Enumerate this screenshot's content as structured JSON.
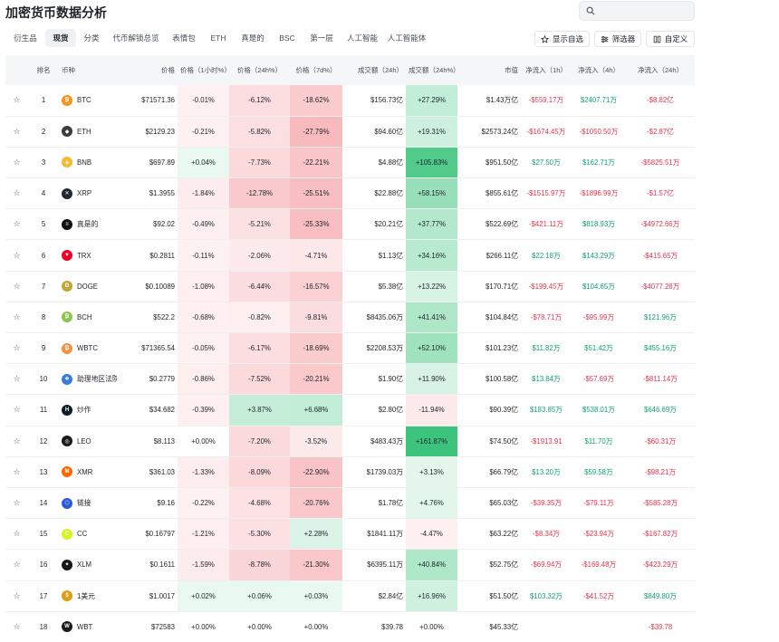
{
  "title": "加密货币数据分析",
  "search": {
    "placeholder": ""
  },
  "tabs": [
    {
      "label": "衍生品",
      "active": false,
      "w": 44
    },
    {
      "label": "现货",
      "active": true,
      "w": 34
    },
    {
      "label": "分类",
      "active": false,
      "w": 34
    },
    {
      "label": "代币解锁总览",
      "active": false,
      "w": 64
    },
    {
      "label": "表情包",
      "active": false,
      "w": 42
    },
    {
      "label": "ETH",
      "active": false,
      "w": 34
    },
    {
      "label": "真是的",
      "active": false,
      "w": 42
    },
    {
      "label": "BSC",
      "active": false,
      "w": 34
    },
    {
      "label": "第一层",
      "active": false,
      "w": 42
    },
    {
      "label": "人工智能",
      "active": false,
      "w": 48
    },
    {
      "label": "人工智能体",
      "active": false,
      "w": 50
    }
  ],
  "actions": {
    "watchlist": "显示自选",
    "filter": "筛选器",
    "custom": "自定义"
  },
  "colors": {
    "neg": "#e8344e",
    "pos": "#0ea46c"
  },
  "columns": [
    "",
    "排名",
    "币种",
    "价格",
    "价格（1小时%）",
    "价格（24h%）",
    "价格（7d%）",
    "成交额（24h）",
    "成交额（24h%）",
    "市值",
    "净流入（1h）",
    "净流入（4h）",
    "净流入（24h）"
  ],
  "rows": [
    {
      "rank": "1",
      "sym": "BTC",
      "icon": "₿",
      "ic": "#f7931a",
      "price": "$71571.36",
      "h1": "-0.01%",
      "h24": "-6.12%",
      "d7": "-18.62%",
      "vol": "$156.73亿",
      "volp": "+27.29%",
      "mcap": "$1.43万亿",
      "in1": "-$559.17万",
      "in4": "$2407.71万",
      "in24": "-$8.82亿"
    },
    {
      "rank": "2",
      "sym": "ETH",
      "icon": "◆",
      "ic": "#3c3c3d",
      "price": "$2129.23",
      "h1": "-0.21%",
      "h24": "-5.82%",
      "d7": "-27.79%",
      "vol": "$94.60亿",
      "volp": "+19.31%",
      "mcap": "$2573.24亿",
      "in1": "-$1674.45万",
      "in4": "-$1050.50万",
      "in24": "-$2.87亿"
    },
    {
      "rank": "3",
      "sym": "BNB",
      "icon": "◈",
      "ic": "#f3ba2f",
      "price": "$697.89",
      "h1": "+0.04%",
      "h24": "-7.73%",
      "d7": "-22.21%",
      "vol": "$4.88亿",
      "volp": "+105.83%",
      "mcap": "$951.50亿",
      "in1": "$27.50万",
      "in4": "$162.71万",
      "in24": "-$5825.51万"
    },
    {
      "rank": "4",
      "sym": "XRP",
      "icon": "✕",
      "ic": "#23292f",
      "price": "$1.3955",
      "h1": "-1.84%",
      "h24": "-12.78%",
      "d7": "-25.51%",
      "vol": "$22.88亿",
      "volp": "+58.15%",
      "mcap": "$855.61亿",
      "in1": "-$1515.97万",
      "in4": "-$1896.99万",
      "in24": "-$1.57亿"
    },
    {
      "rank": "5",
      "sym": "真是的",
      "icon": "≡",
      "ic": "#111111",
      "price": "$92.02",
      "h1": "-0.49%",
      "h24": "-5.21%",
      "d7": "-25.33%",
      "vol": "$20.21亿",
      "volp": "+37.77%",
      "mcap": "$522.69亿",
      "in1": "-$421.11万",
      "in4": "$818.93万",
      "in24": "-$4972.66万"
    },
    {
      "rank": "6",
      "sym": "TRX",
      "icon": "▼",
      "ic": "#ef0027",
      "price": "$0.2811",
      "h1": "-0.11%",
      "h24": "-2.06%",
      "d7": "-4.71%",
      "vol": "$1.13亿",
      "volp": "+34.16%",
      "mcap": "$266.11亿",
      "in1": "$22.18万",
      "in4": "$143.29万",
      "in24": "-$415.65万"
    },
    {
      "rank": "7",
      "sym": "DOGE",
      "icon": "Ð",
      "ic": "#c2a633",
      "price": "$0.10089",
      "h1": "-1.08%",
      "h24": "-6.44%",
      "d7": "-16.57%",
      "vol": "$5.38亿",
      "volp": "+13.22%",
      "mcap": "$170.71亿",
      "in1": "-$199.45万",
      "in4": "$104.65万",
      "in24": "-$4077.28万"
    },
    {
      "rank": "8",
      "sym": "BCH",
      "icon": "₿",
      "ic": "#8dc351",
      "price": "$522.2",
      "h1": "-0.68%",
      "h24": "-0.82%",
      "d7": "-9.81%",
      "vol": "$8435.06万",
      "volp": "+41.41%",
      "mcap": "$104.84亿",
      "in1": "-$78.71万",
      "in4": "-$95.99万",
      "in24": "$121.96万"
    },
    {
      "rank": "9",
      "sym": "WBTC",
      "icon": "₿",
      "ic": "#f09242",
      "price": "$71365.54",
      "h1": "-0.05%",
      "h24": "-6.17%",
      "d7": "-18.69%",
      "vol": "$2208.53万",
      "volp": "+52.10%",
      "mcap": "$101.23亿",
      "in1": "$11.82万",
      "in4": "$51.42万",
      "in24": "$455.16万"
    },
    {
      "rank": "10",
      "sym": "助理地区法院",
      "icon": "❖",
      "ic": "#3b7bd8",
      "price": "$0.2779",
      "h1": "-0.86%",
      "h24": "-7.52%",
      "d7": "-20.21%",
      "vol": "$1.90亿",
      "volp": "+11.90%",
      "mcap": "$100.58亿",
      "in1": "$13.84万",
      "in4": "-$57.69万",
      "in24": "-$811.14万"
    },
    {
      "rank": "11",
      "sym": "炒作",
      "icon": "H",
      "ic": "#0b1f24",
      "price": "$34.682",
      "h1": "-0.39%",
      "h24": "+3.87%",
      "d7": "+6.68%",
      "vol": "$2.80亿",
      "volp": "-11.94%",
      "mcap": "$90.39亿",
      "in1": "$183.85万",
      "in4": "$538.01万",
      "in24": "$646.69万"
    },
    {
      "rank": "12",
      "sym": "LEO",
      "icon": "◎",
      "ic": "#1a1a1a",
      "price": "$8.113",
      "h1": "+0.00%",
      "h24": "-7.20%",
      "d7": "-3.52%",
      "vol": "$483.43万",
      "volp": "+161.87%",
      "mcap": "$74.50亿",
      "in1": "-$1913.91",
      "in4": "$11.70万",
      "in24": "-$60.31万"
    },
    {
      "rank": "13",
      "sym": "XMR",
      "icon": "M",
      "ic": "#ff6600",
      "price": "$361.03",
      "h1": "-1.33%",
      "h24": "-8.09%",
      "d7": "-22.90%",
      "vol": "$1739.03万",
      "volp": "+3.13%",
      "mcap": "$66.79亿",
      "in1": "$13.20万",
      "in4": "$59.58万",
      "in24": "-$98.21万"
    },
    {
      "rank": "14",
      "sym": "链接",
      "icon": "⬡",
      "ic": "#2a5ada",
      "price": "$9.16",
      "h1": "-0.22%",
      "h24": "-4.68%",
      "d7": "-20.76%",
      "vol": "$1.78亿",
      "volp": "+4.76%",
      "mcap": "$65.03亿",
      "in1": "-$39.35万",
      "in4": "-$79.11万",
      "in24": "-$585.28万"
    },
    {
      "rank": "15",
      "sym": "CC",
      "icon": "C",
      "ic": "#d6f21f",
      "price": "$0.16797",
      "h1": "-1.21%",
      "h24": "-5.30%",
      "d7": "+2.28%",
      "vol": "$1841.11万",
      "volp": "-4.47%",
      "mcap": "$63.22亿",
      "in1": "-$8.34万",
      "in4": "-$23.94万",
      "in24": "-$167.82万"
    },
    {
      "rank": "16",
      "sym": "XLM",
      "icon": "✦",
      "ic": "#14161a",
      "price": "$0.1611",
      "h1": "-1.59%",
      "h24": "-8.78%",
      "d7": "-21.30%",
      "vol": "$6395.11万",
      "volp": "+40.84%",
      "mcap": "$52.75亿",
      "in1": "-$69.94万",
      "in4": "-$169.48万",
      "in24": "-$423.29万"
    },
    {
      "rank": "17",
      "sym": "1美元",
      "icon": "$",
      "ic": "#e09c12",
      "price": "$1.0017",
      "h1": "+0.02%",
      "h24": "+0.06%",
      "d7": "+0.03%",
      "vol": "$2.84亿",
      "volp": "+16.96%",
      "mcap": "$51.50亿",
      "in1": "$103.32万",
      "in4": "-$41.52万",
      "in24": "$849.80万"
    },
    {
      "rank": "18",
      "sym": "WBT",
      "icon": "W",
      "ic": "#1a1a1a",
      "price": "$72583",
      "h1": "+0.00%",
      "h24": "+0.00%",
      "d7": "+0.00%",
      "vol": "$39.78",
      "volp": "+0.00%",
      "mcap": "$45.33亿",
      "in1": "",
      "in4": "",
      "in24": "-$39.78"
    }
  ]
}
